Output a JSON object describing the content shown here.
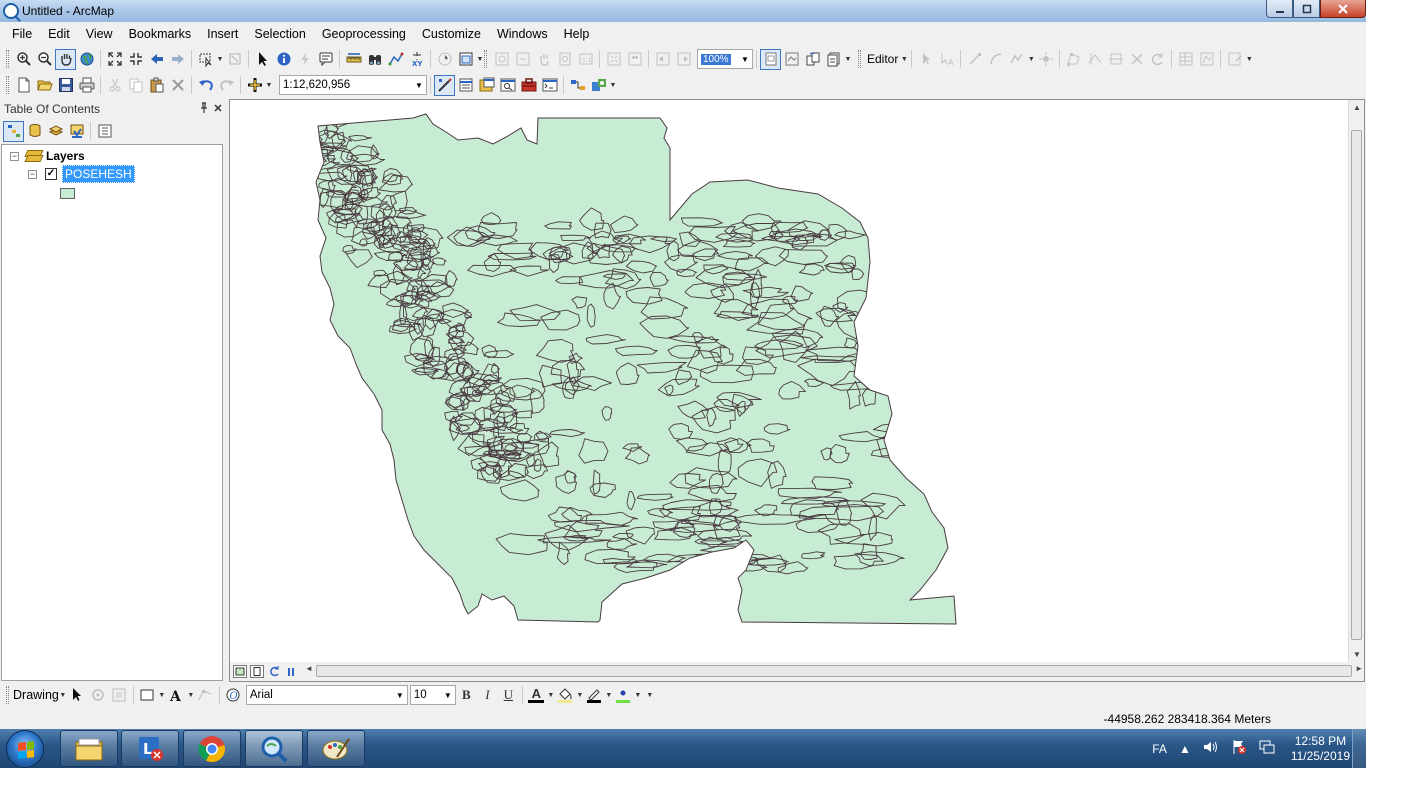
{
  "window": {
    "title": "Untitled - ArcMap",
    "controls": [
      "minimize-icon",
      "maximize-icon",
      "close-icon"
    ]
  },
  "menu": [
    "File",
    "Edit",
    "View",
    "Bookmarks",
    "Insert",
    "Selection",
    "Geoprocessing",
    "Customize",
    "Windows",
    "Help"
  ],
  "toolbar": {
    "zoom_percent": "100%",
    "editor_label": "Editor",
    "scale_value": "1:12,620,956"
  },
  "toc": {
    "title": "Table Of Contents",
    "root_label": "Layers",
    "layer": {
      "name": "POSEHESH",
      "checked": true,
      "symbol_fill": "#c7ecd3"
    }
  },
  "map": {
    "fill_color": "#c7ecd3",
    "outline_color": "#4a3a42"
  },
  "drawing": {
    "label": "Drawing",
    "font_name": "Arial",
    "font_size": "10",
    "bold": "B",
    "italic": "I",
    "underline": "U",
    "font_color_letter": "A"
  },
  "status": {
    "coordinates": "-44958.262  283418.364 Meters"
  },
  "taskbar": {
    "language": "FA",
    "time": "12:58 PM",
    "date": "11/25/2019",
    "apps": [
      "windows-explorer-icon",
      "lync-icon",
      "chrome-icon",
      "arcmap-icon",
      "paint-icon"
    ]
  }
}
